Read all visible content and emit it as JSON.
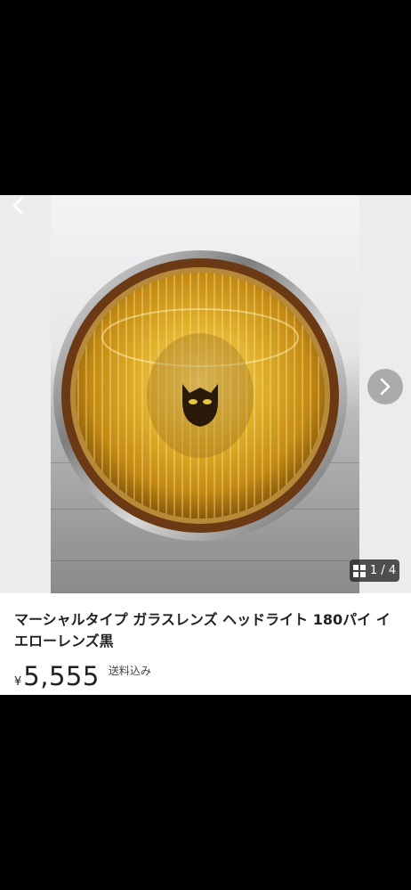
{
  "viewer": {
    "counter_text": "1 / 4",
    "image_alt": "ヘッドライト 写真",
    "back_icon": "chevron-left-icon",
    "next_icon": "chevron-right-icon",
    "gallery_icon": "grid-icon",
    "lens_color": "#d9a520",
    "chrome_color": "#9a9a9a"
  },
  "product": {
    "title": "マーシャルタイプ ガラスレンズ ヘッドライト 180パイ イエローレンズ黒",
    "price_symbol": "¥",
    "price": "5,555",
    "shipping_note": "送料込み"
  }
}
